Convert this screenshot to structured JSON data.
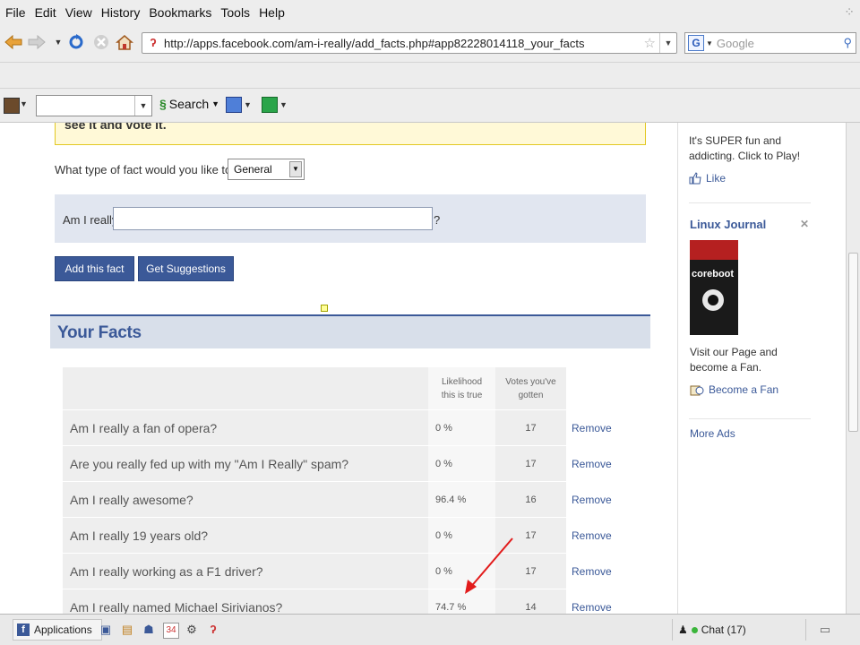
{
  "menubar": {
    "items": [
      "File",
      "Edit",
      "View",
      "History",
      "Bookmarks",
      "Tools",
      "Help"
    ]
  },
  "navbar": {
    "url": "http://apps.facebook.com/am-i-really/add_facts.php#app82228014118_your_facts",
    "search_placeholder": "Google"
  },
  "toolbar2": {
    "search_label": "Search"
  },
  "page": {
    "notice_text": "see it and vote it.",
    "question_label": "What type of fact would you like to add?",
    "fact_type_selected": "General",
    "am_i_really_label": "Am I really",
    "question_mark": "?",
    "add_button": "Add this fact",
    "suggest_button": "Get Suggestions",
    "facts_title": "Your Facts",
    "table": {
      "headers": [
        "",
        "Likelihood this is true",
        "Votes you've gotten",
        ""
      ],
      "rows": [
        {
          "fact": "Am I really a fan of opera?",
          "likelihood": "0 %",
          "votes": "17",
          "action": "Remove"
        },
        {
          "fact": "Are you really fed up with my \"Am I Really\" spam?",
          "likelihood": "0 %",
          "votes": "17",
          "action": "Remove"
        },
        {
          "fact": "Am I really awesome?",
          "likelihood": "96.4 %",
          "votes": "16",
          "action": "Remove"
        },
        {
          "fact": "Am I really 19 years old?",
          "likelihood": "0 %",
          "votes": "17",
          "action": "Remove"
        },
        {
          "fact": "Am I really working as a F1 driver?",
          "likelihood": "0 %",
          "votes": "17",
          "action": "Remove"
        },
        {
          "fact": "Am I really named Michael Sirivianos?",
          "likelihood": "74.7 %",
          "votes": "14",
          "action": "Remove"
        }
      ]
    }
  },
  "ads": {
    "ad1_text": "It's SUPER fun and addicting. Click to Play!",
    "ad1_like": "Like",
    "ad2_title": "Linux Journal",
    "ad2_cover_text": "coreboot",
    "ad2_text": "Visit our Page and become a Fan.",
    "ad2_fan": "Become a Fan",
    "more_ads": "More Ads"
  },
  "bottombar": {
    "applications": "Applications",
    "chat_label": "Chat (17)"
  },
  "colors": {
    "facebook_blue": "#3b5998",
    "notice_bg": "#fff9d7",
    "arrow_red": "#e21b1b"
  }
}
